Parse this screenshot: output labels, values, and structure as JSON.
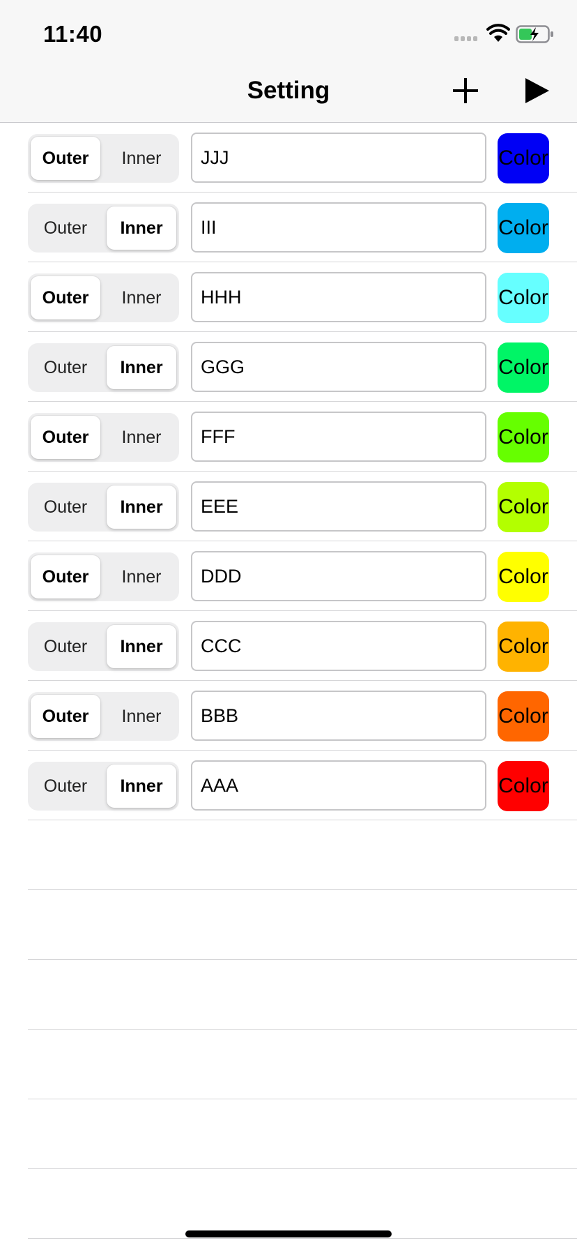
{
  "status_bar": {
    "time": "11:40",
    "icons": [
      "cellular-signal-icon",
      "wifi-icon",
      "battery-charging-icon"
    ]
  },
  "nav": {
    "title": "Setting",
    "add_icon": "plus-icon",
    "play_icon": "play-icon"
  },
  "segment_labels": {
    "outer": "Outer",
    "inner": "Inner"
  },
  "rows": [
    {
      "selected": "outer",
      "name": "JJJ",
      "color": "#0000f5",
      "color_label": "Color"
    },
    {
      "selected": "inner",
      "name": "III",
      "color": "#00aeef",
      "color_label": "Color"
    },
    {
      "selected": "outer",
      "name": "HHH",
      "color": "#66ffff",
      "color_label": "Color"
    },
    {
      "selected": "inner",
      "name": "GGG",
      "color": "#00f566",
      "color_label": "Color"
    },
    {
      "selected": "outer",
      "name": "FFF",
      "color": "#66ff00",
      "color_label": "Color"
    },
    {
      "selected": "inner",
      "name": "EEE",
      "color": "#b3ff00",
      "color_label": "Color"
    },
    {
      "selected": "outer",
      "name": "DDD",
      "color": "#ffff00",
      "color_label": "Color"
    },
    {
      "selected": "inner",
      "name": "CCC",
      "color": "#ffb300",
      "color_label": "Color"
    },
    {
      "selected": "outer",
      "name": "BBB",
      "color": "#ff6600",
      "color_label": "Color"
    },
    {
      "selected": "inner",
      "name": "AAA",
      "color": "#ff0000",
      "color_label": "Color"
    }
  ],
  "empty_rows": 6
}
